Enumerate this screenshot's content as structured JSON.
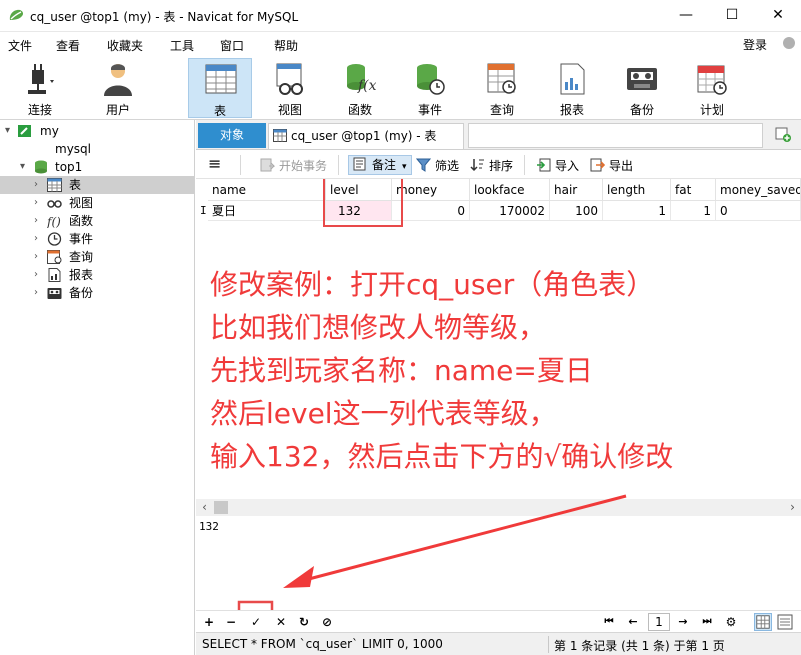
{
  "window": {
    "title": "cq_user @top1 (my) - 表 - Navicat for MySQL",
    "controls": [
      "—",
      "☐",
      "✕"
    ]
  },
  "menu": {
    "items": [
      "文件",
      "查看",
      "收藏夹",
      "工具",
      "窗口",
      "帮助"
    ],
    "login": "登录"
  },
  "toolbar": {
    "items": [
      {
        "label": "连接",
        "icon": "plug-icon"
      },
      {
        "label": "用户",
        "icon": "user-icon"
      },
      {
        "label": "表",
        "icon": "table-icon",
        "active": true
      },
      {
        "label": "视图",
        "icon": "view-icon"
      },
      {
        "label": "函数",
        "icon": "function-icon"
      },
      {
        "label": "事件",
        "icon": "event-icon"
      },
      {
        "label": "查询",
        "icon": "query-icon"
      },
      {
        "label": "报表",
        "icon": "report-icon"
      },
      {
        "label": "备份",
        "icon": "backup-icon"
      },
      {
        "label": "计划",
        "icon": "schedule-icon"
      }
    ]
  },
  "sidebar": {
    "tree": [
      {
        "label": "my",
        "level": 0,
        "expanded": true
      },
      {
        "label": "mysql",
        "level": 1
      },
      {
        "label": "top1",
        "level": 1,
        "expanded": true
      },
      {
        "label": "表",
        "level": 2,
        "selected": true
      },
      {
        "label": "视图",
        "level": 2
      },
      {
        "label": "函数",
        "level": 2
      },
      {
        "label": "事件",
        "level": 2
      },
      {
        "label": "查询",
        "level": 2
      },
      {
        "label": "报表",
        "level": 2
      },
      {
        "label": "备份",
        "level": 2
      }
    ]
  },
  "tabs": {
    "objects": "对象",
    "table_tab": "cq_user @top1 (my) - 表"
  },
  "grid_toolbar": {
    "menu_icon": "≡",
    "begin_transaction": "开始事务",
    "note": "备注",
    "filter": "筛选",
    "sort": "排序",
    "import": "导入",
    "export": "导出"
  },
  "grid": {
    "columns": [
      "name",
      "level",
      "money",
      "lookface",
      "hair",
      "length",
      "fat",
      "money_saved"
    ],
    "rows": [
      [
        "夏日",
        "132",
        "0",
        "170002",
        "100",
        "1",
        "1",
        "0"
      ]
    ],
    "row_marker": "I"
  },
  "annotation": {
    "lines": [
      "修改案例：打开cq_user（角色表）",
      "比如我们想修改人物等级，",
      "先找到玩家名称：name=夏日",
      "然后level这一列代表等级，",
      "输入132，然后点击下方的√确认修改"
    ],
    "color": "#f03a3a"
  },
  "value_viewer": {
    "value": "132"
  },
  "nav": {
    "add": "+",
    "delete": "−",
    "apply": "✓",
    "discard": "✕",
    "refresh": "↻",
    "stop": "⊘",
    "page": "1"
  },
  "status": {
    "sql": "SELECT * FROM `cq_user` LIMIT 0, 1000",
    "records": "第 1 条记录 (共 1 条) 于第 1 页"
  }
}
